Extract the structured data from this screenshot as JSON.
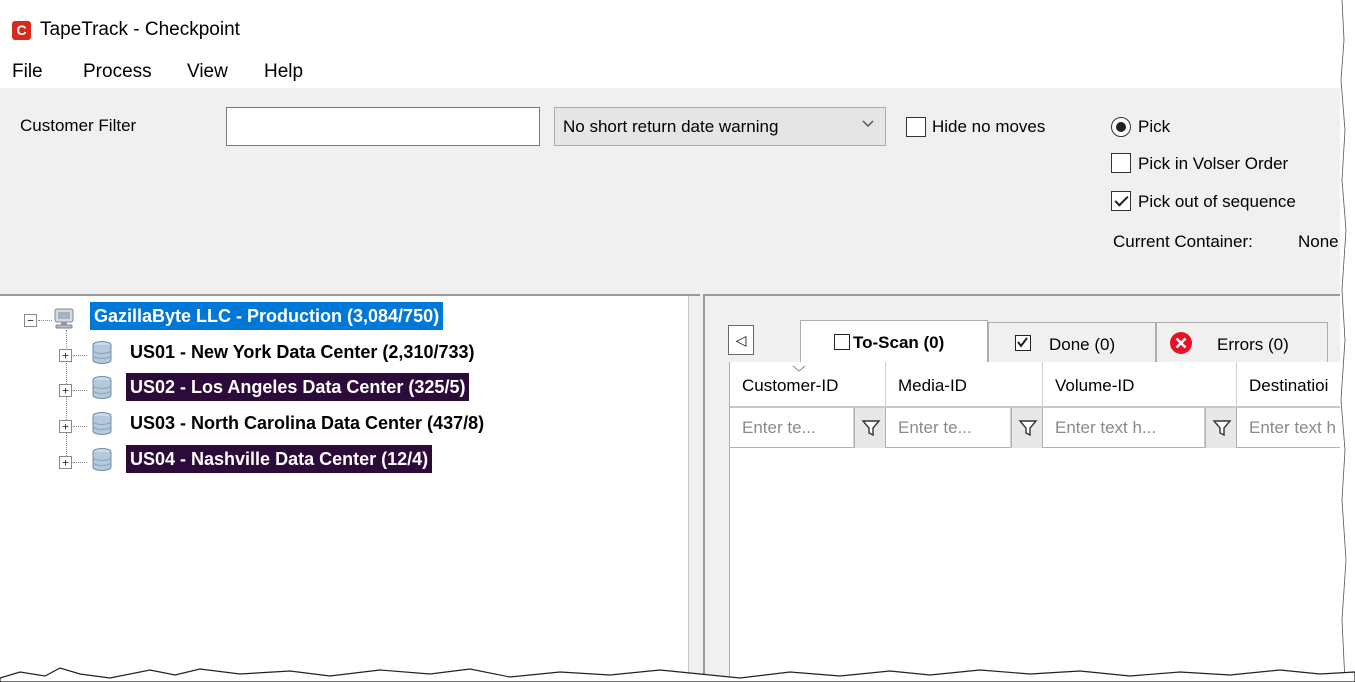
{
  "window": {
    "title": "TapeTrack - Checkpoint",
    "app_icon_letter": "C"
  },
  "menu": [
    "File",
    "Process",
    "View",
    "Help"
  ],
  "toolbar": {
    "customer_filter_label": "Customer Filter",
    "customer_filter_value": "",
    "warning_select_value": "No short return date warning",
    "hide_no_moves_label": "Hide no moves",
    "hide_no_moves_checked": false,
    "pick_label": "Pick",
    "pick_selected": true,
    "pick_volser_label": "Pick in Volser Order",
    "pick_volser_checked": false,
    "pick_sequence_label": "Pick out of sequence",
    "pick_sequence_checked": true,
    "current_container_label": "Current Container:",
    "current_container_value": "None"
  },
  "tree": {
    "root": "GazillaByte LLC - Production (3,084/750)",
    "children": [
      "US01 - New York Data Center (2,310/733)",
      "US02 - Los Angeles Data Center (325/5)",
      "US03 - North Carolina Data Center (437/8)",
      "US04 - Nashville Data Center (12/4)"
    ]
  },
  "tabs": [
    {
      "label": "To-Scan (0)",
      "icon": "checkbox-empty-icon"
    },
    {
      "label": "Done (0)",
      "icon": "checkbox-checked-icon"
    },
    {
      "label": "Errors (0)",
      "icon": "error-icon"
    }
  ],
  "tab_scroll_glyph": "◁",
  "grid": {
    "columns": [
      "Customer-ID",
      "Media-ID",
      "Volume-ID",
      "Destinatioi"
    ],
    "filter_placeholders": [
      "Enter te...",
      "Enter te...",
      "Enter text h...",
      "Enter text h"
    ]
  },
  "colors": {
    "selection_blue": "#0078d7",
    "selection_dark": "#2c0b3a",
    "error_red": "#e81123"
  }
}
